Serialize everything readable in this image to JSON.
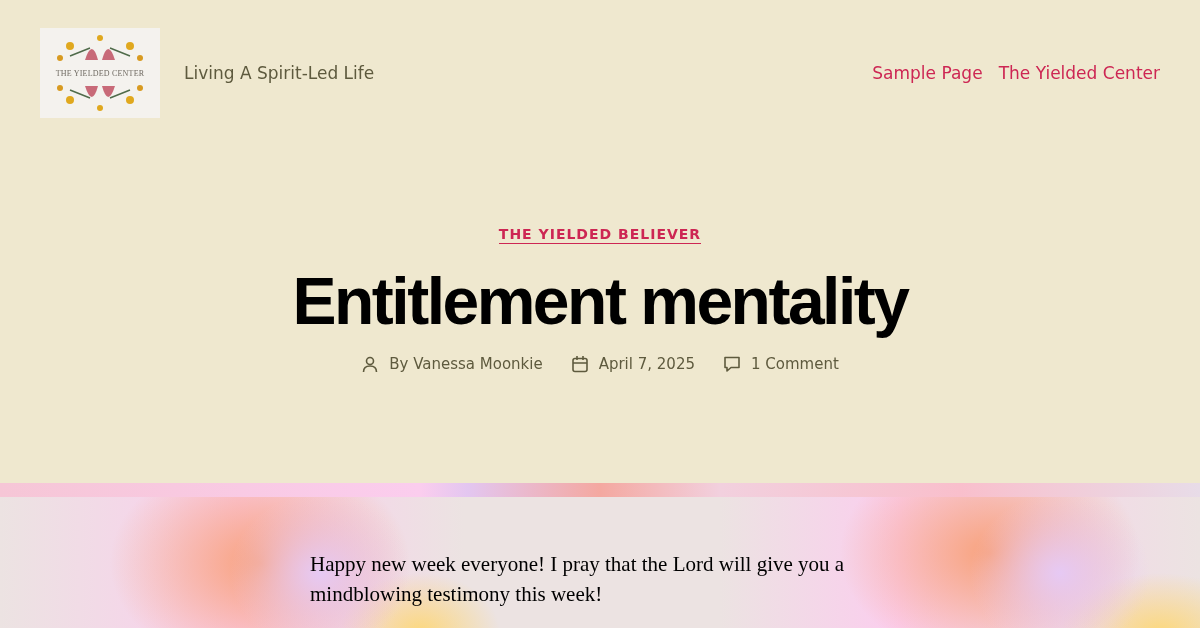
{
  "header": {
    "logo_text": "THE YIELDED CENTER",
    "tagline": "Living A Spirit-Led Life",
    "nav": [
      {
        "label": "Sample Page"
      },
      {
        "label": "The Yielded Center"
      }
    ]
  },
  "post": {
    "category": "THE YIELDED BELIEVER",
    "title": "Entitlement mentality",
    "meta": [
      {
        "kind": "author",
        "text": "By Vanessa Moonkie"
      },
      {
        "kind": "date",
        "text": "April 7, 2025"
      },
      {
        "kind": "comments",
        "text": "1 Comment"
      }
    ],
    "body": "Happy new week everyone! I pray that the Lord will give you a mindblowing testimony this week!"
  }
}
